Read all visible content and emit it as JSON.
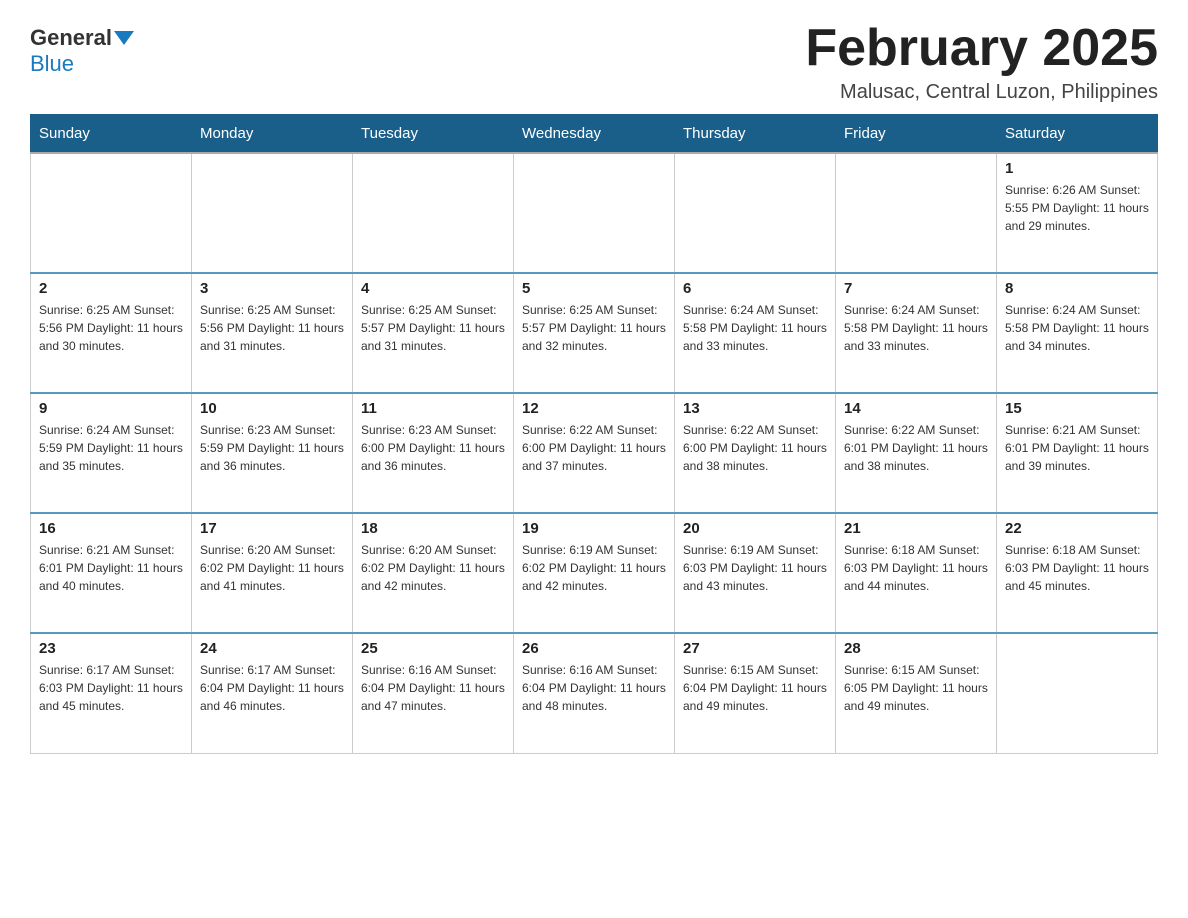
{
  "logo": {
    "general": "General",
    "blue": "Blue"
  },
  "header": {
    "title": "February 2025",
    "location": "Malusac, Central Luzon, Philippines"
  },
  "weekdays": [
    "Sunday",
    "Monday",
    "Tuesday",
    "Wednesday",
    "Thursday",
    "Friday",
    "Saturday"
  ],
  "weeks": [
    [
      {
        "day": "",
        "info": ""
      },
      {
        "day": "",
        "info": ""
      },
      {
        "day": "",
        "info": ""
      },
      {
        "day": "",
        "info": ""
      },
      {
        "day": "",
        "info": ""
      },
      {
        "day": "",
        "info": ""
      },
      {
        "day": "1",
        "info": "Sunrise: 6:26 AM\nSunset: 5:55 PM\nDaylight: 11 hours and 29 minutes."
      }
    ],
    [
      {
        "day": "2",
        "info": "Sunrise: 6:25 AM\nSunset: 5:56 PM\nDaylight: 11 hours and 30 minutes."
      },
      {
        "day": "3",
        "info": "Sunrise: 6:25 AM\nSunset: 5:56 PM\nDaylight: 11 hours and 31 minutes."
      },
      {
        "day": "4",
        "info": "Sunrise: 6:25 AM\nSunset: 5:57 PM\nDaylight: 11 hours and 31 minutes."
      },
      {
        "day": "5",
        "info": "Sunrise: 6:25 AM\nSunset: 5:57 PM\nDaylight: 11 hours and 32 minutes."
      },
      {
        "day": "6",
        "info": "Sunrise: 6:24 AM\nSunset: 5:58 PM\nDaylight: 11 hours and 33 minutes."
      },
      {
        "day": "7",
        "info": "Sunrise: 6:24 AM\nSunset: 5:58 PM\nDaylight: 11 hours and 33 minutes."
      },
      {
        "day": "8",
        "info": "Sunrise: 6:24 AM\nSunset: 5:58 PM\nDaylight: 11 hours and 34 minutes."
      }
    ],
    [
      {
        "day": "9",
        "info": "Sunrise: 6:24 AM\nSunset: 5:59 PM\nDaylight: 11 hours and 35 minutes."
      },
      {
        "day": "10",
        "info": "Sunrise: 6:23 AM\nSunset: 5:59 PM\nDaylight: 11 hours and 36 minutes."
      },
      {
        "day": "11",
        "info": "Sunrise: 6:23 AM\nSunset: 6:00 PM\nDaylight: 11 hours and 36 minutes."
      },
      {
        "day": "12",
        "info": "Sunrise: 6:22 AM\nSunset: 6:00 PM\nDaylight: 11 hours and 37 minutes."
      },
      {
        "day": "13",
        "info": "Sunrise: 6:22 AM\nSunset: 6:00 PM\nDaylight: 11 hours and 38 minutes."
      },
      {
        "day": "14",
        "info": "Sunrise: 6:22 AM\nSunset: 6:01 PM\nDaylight: 11 hours and 38 minutes."
      },
      {
        "day": "15",
        "info": "Sunrise: 6:21 AM\nSunset: 6:01 PM\nDaylight: 11 hours and 39 minutes."
      }
    ],
    [
      {
        "day": "16",
        "info": "Sunrise: 6:21 AM\nSunset: 6:01 PM\nDaylight: 11 hours and 40 minutes."
      },
      {
        "day": "17",
        "info": "Sunrise: 6:20 AM\nSunset: 6:02 PM\nDaylight: 11 hours and 41 minutes."
      },
      {
        "day": "18",
        "info": "Sunrise: 6:20 AM\nSunset: 6:02 PM\nDaylight: 11 hours and 42 minutes."
      },
      {
        "day": "19",
        "info": "Sunrise: 6:19 AM\nSunset: 6:02 PM\nDaylight: 11 hours and 42 minutes."
      },
      {
        "day": "20",
        "info": "Sunrise: 6:19 AM\nSunset: 6:03 PM\nDaylight: 11 hours and 43 minutes."
      },
      {
        "day": "21",
        "info": "Sunrise: 6:18 AM\nSunset: 6:03 PM\nDaylight: 11 hours and 44 minutes."
      },
      {
        "day": "22",
        "info": "Sunrise: 6:18 AM\nSunset: 6:03 PM\nDaylight: 11 hours and 45 minutes."
      }
    ],
    [
      {
        "day": "23",
        "info": "Sunrise: 6:17 AM\nSunset: 6:03 PM\nDaylight: 11 hours and 45 minutes."
      },
      {
        "day": "24",
        "info": "Sunrise: 6:17 AM\nSunset: 6:04 PM\nDaylight: 11 hours and 46 minutes."
      },
      {
        "day": "25",
        "info": "Sunrise: 6:16 AM\nSunset: 6:04 PM\nDaylight: 11 hours and 47 minutes."
      },
      {
        "day": "26",
        "info": "Sunrise: 6:16 AM\nSunset: 6:04 PM\nDaylight: 11 hours and 48 minutes."
      },
      {
        "day": "27",
        "info": "Sunrise: 6:15 AM\nSunset: 6:04 PM\nDaylight: 11 hours and 49 minutes."
      },
      {
        "day": "28",
        "info": "Sunrise: 6:15 AM\nSunset: 6:05 PM\nDaylight: 11 hours and 49 minutes."
      },
      {
        "day": "",
        "info": ""
      }
    ]
  ]
}
